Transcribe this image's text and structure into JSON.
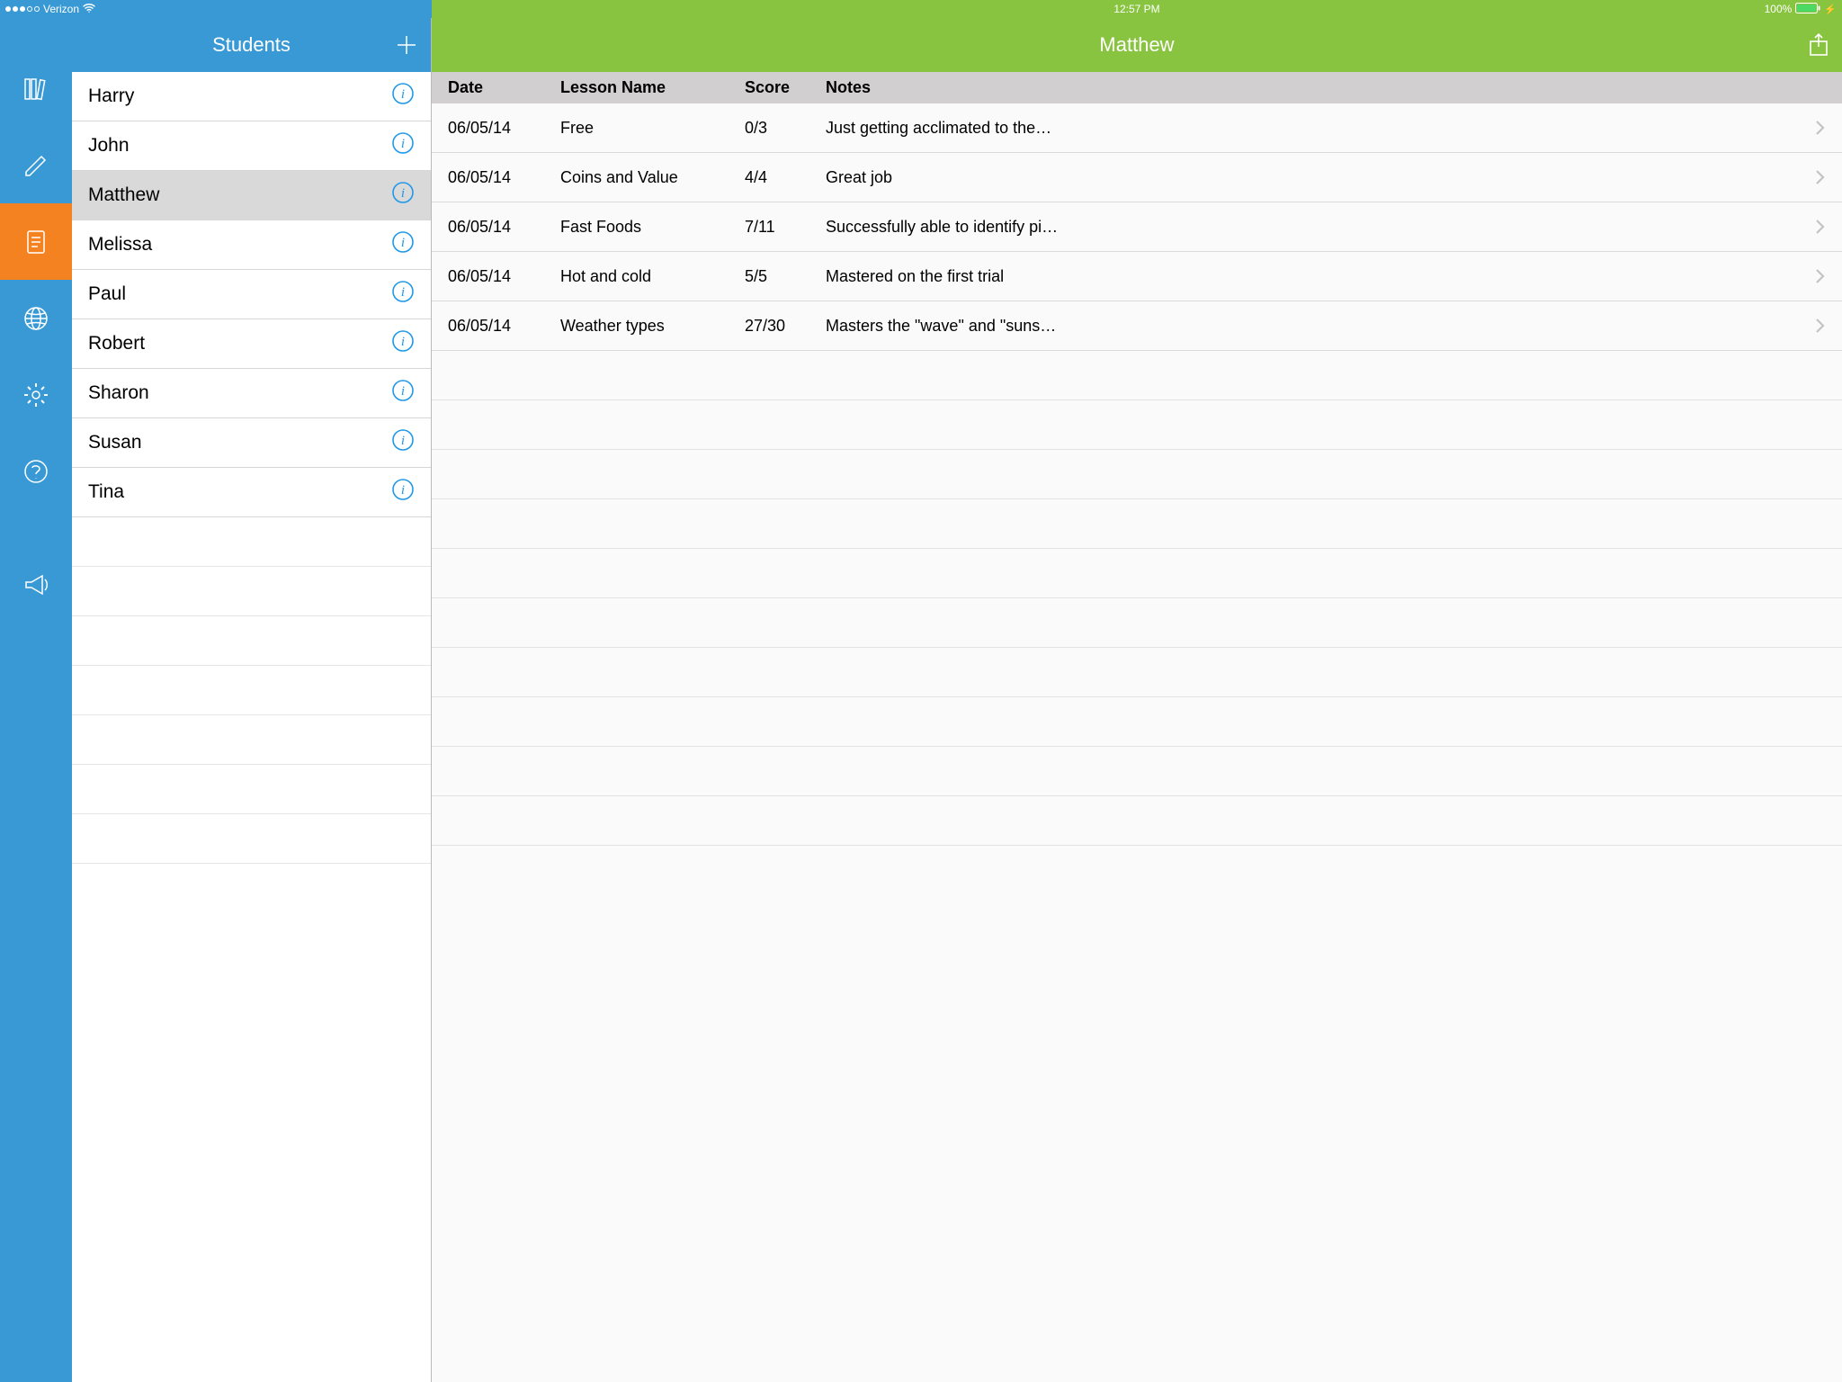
{
  "status": {
    "carrier": "Verizon",
    "time": "12:57 PM",
    "battery_pct": "100%"
  },
  "students_header": {
    "title": "Students"
  },
  "students": [
    {
      "name": "Harry",
      "selected": false
    },
    {
      "name": "John",
      "selected": false
    },
    {
      "name": "Matthew",
      "selected": true
    },
    {
      "name": "Melissa",
      "selected": false
    },
    {
      "name": "Paul",
      "selected": false
    },
    {
      "name": "Robert",
      "selected": false
    },
    {
      "name": "Sharon",
      "selected": false
    },
    {
      "name": "Susan",
      "selected": false
    },
    {
      "name": "Tina",
      "selected": false
    }
  ],
  "detail": {
    "title": "Matthew",
    "columns": {
      "date": "Date",
      "lesson": "Lesson Name",
      "score": "Score",
      "notes": "Notes"
    },
    "lessons": [
      {
        "date": "06/05/14",
        "name": "Free",
        "score": "0/3",
        "notes": "Just getting acclimated to the…"
      },
      {
        "date": "06/05/14",
        "name": "Coins and Value",
        "score": "4/4",
        "notes": "Great job"
      },
      {
        "date": "06/05/14",
        "name": "Fast Foods",
        "score": "7/11",
        "notes": "Successfully able to identify pi…"
      },
      {
        "date": "06/05/14",
        "name": "Hot and cold",
        "score": "5/5",
        "notes": "Mastered on the first trial"
      },
      {
        "date": "06/05/14",
        "name": "Weather types",
        "score": "27/30",
        "notes": "Masters the \"wave\" and \"suns…"
      }
    ]
  }
}
